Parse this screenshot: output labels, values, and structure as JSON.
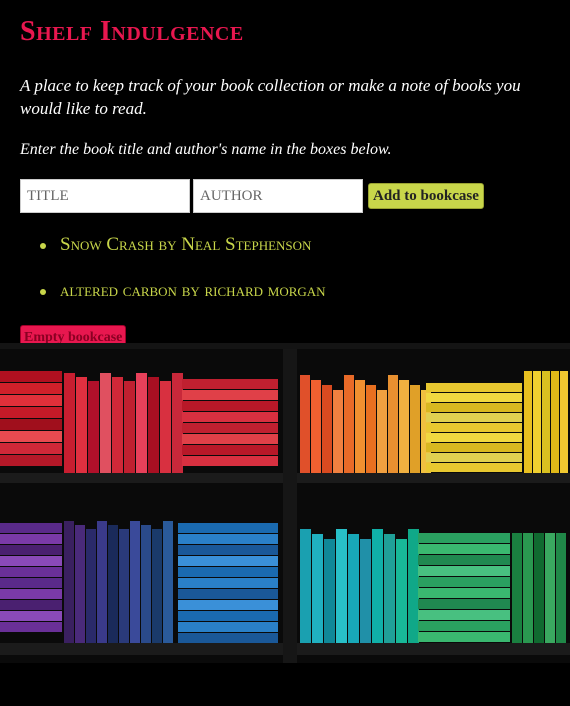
{
  "header": {
    "title": "Shelf Indulgence"
  },
  "intro": "A place to keep track of your book collection or make a note of books you would like to read.",
  "instruction": "Enter the book title and author's name in the boxes below.",
  "form": {
    "title_placeholder": "TITLE",
    "author_placeholder": "AUTHOR",
    "add_label": "Add to bookcase"
  },
  "books": [
    "Snow Crash by Neal Stephenson",
    "altered carbon by richard morgan"
  ],
  "empty_label": "Empty bookcase",
  "colors": {
    "accent_pink": "#e8174f",
    "accent_lime": "#c8d64a",
    "background": "#000000"
  }
}
